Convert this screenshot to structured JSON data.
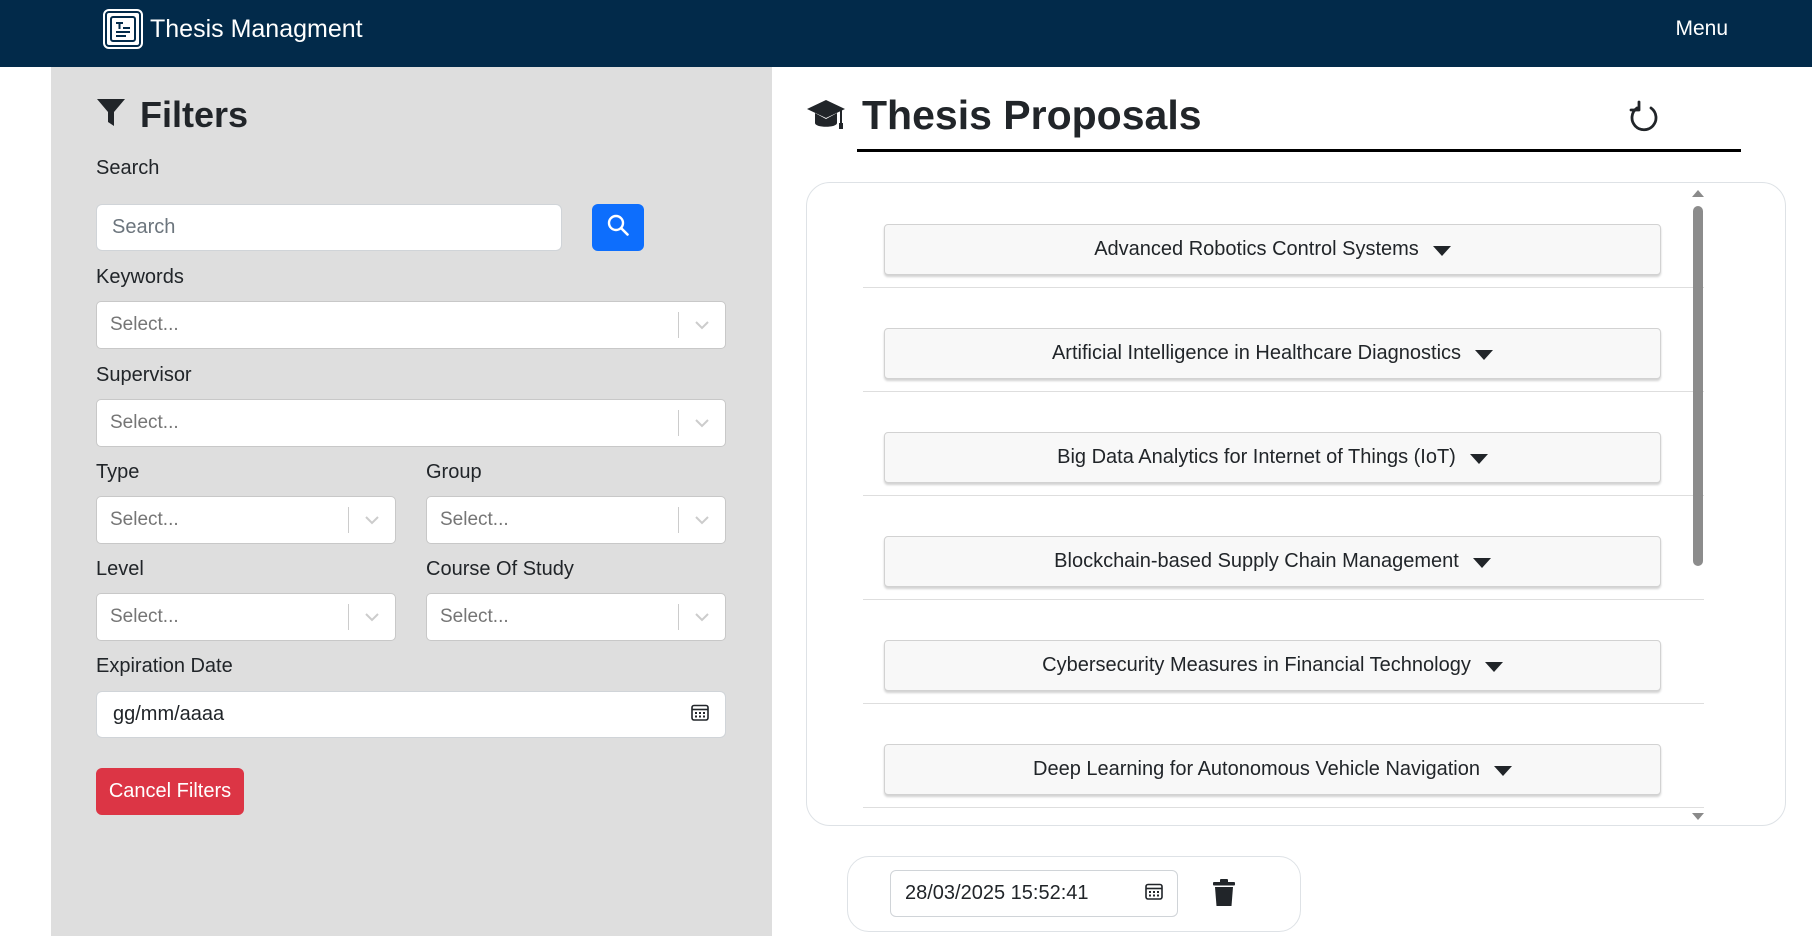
{
  "app": {
    "title": "Thesis Managment",
    "menu_label": "Menu"
  },
  "filters": {
    "heading": "Filters",
    "search": {
      "label": "Search",
      "placeholder": "Search"
    },
    "keywords": {
      "label": "Keywords",
      "placeholder": "Select..."
    },
    "supervisor": {
      "label": "Supervisor",
      "placeholder": "Select..."
    },
    "type": {
      "label": "Type",
      "placeholder": "Select..."
    },
    "group": {
      "label": "Group",
      "placeholder": "Select..."
    },
    "level": {
      "label": "Level",
      "placeholder": "Select..."
    },
    "course_of_study": {
      "label": "Course Of Study",
      "placeholder": "Select..."
    },
    "expiration_date": {
      "label": "Expiration Date",
      "placeholder": "gg/mm/aaaa"
    },
    "cancel_label": "Cancel Filters"
  },
  "proposals": {
    "heading": "Thesis Proposals",
    "items": [
      "Advanced Robotics Control Systems",
      "Artificial Intelligence in Healthcare Diagnostics",
      "Big Data Analytics for Internet of Things (IoT)",
      "Blockchain-based Supply Chain Management",
      "Cybersecurity Measures in Financial Technology",
      "Deep Learning for Autonomous Vehicle Navigation"
    ]
  },
  "virtual_clock": {
    "value": "28/03/2025 15:52:41"
  },
  "colors": {
    "navbar": "#022a4a",
    "filters_panel": "#dedede",
    "primary": "#0d6efd",
    "danger": "#dc3545"
  },
  "icons": {
    "brand": "document-logo-icon",
    "filters": "funnel-icon",
    "search": "search-icon",
    "select_chevron": "chevron-down-icon",
    "calendar": "calendar-icon",
    "proposals": "graduation-cap-icon",
    "refresh": "refresh-icon",
    "item_toggle": "caret-down-icon",
    "delete": "trash-icon"
  }
}
